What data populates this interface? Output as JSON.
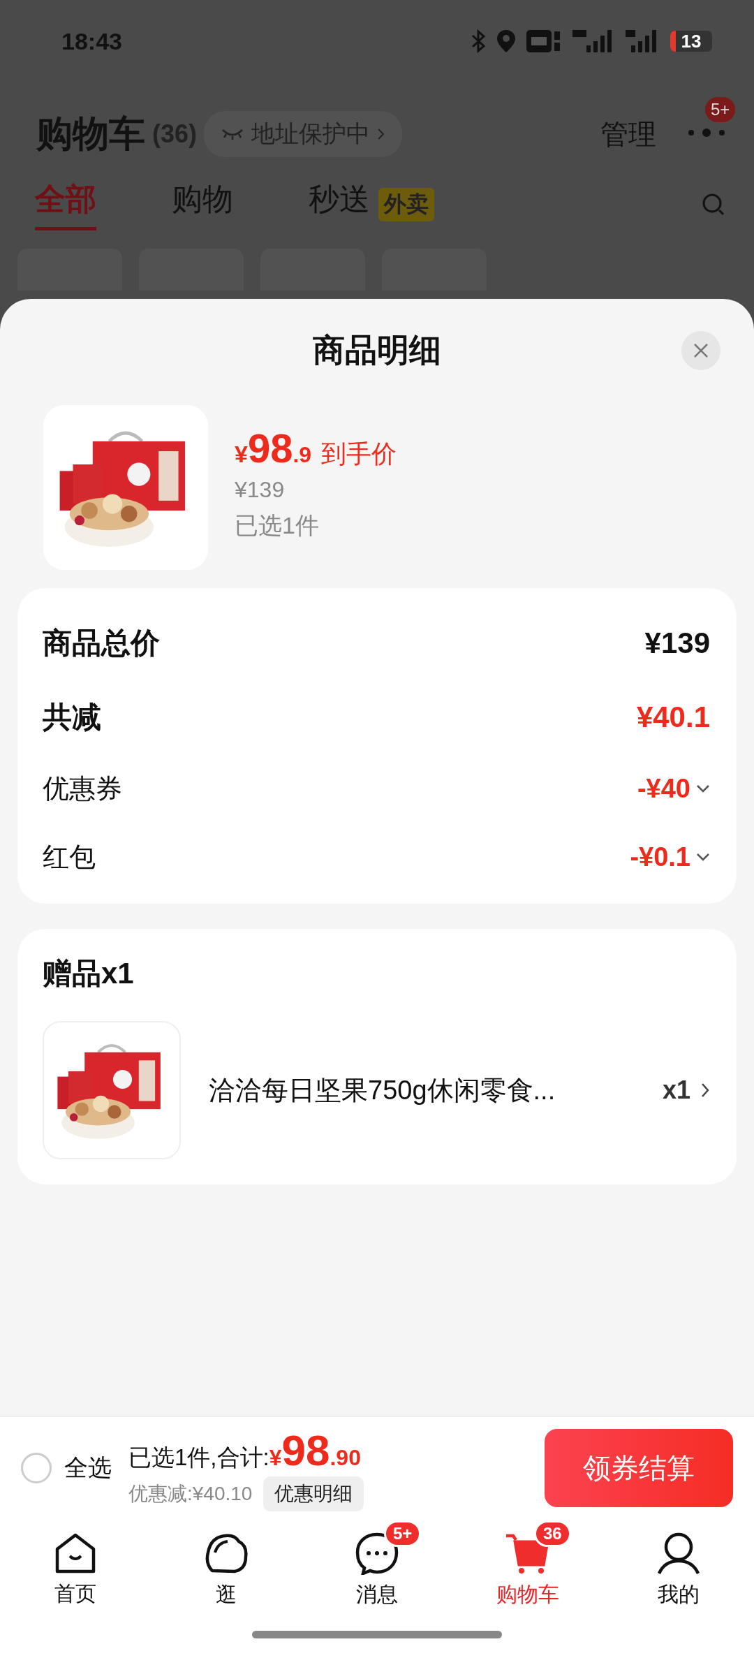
{
  "status_bar": {
    "time": "18:43",
    "battery": "13"
  },
  "header": {
    "title": "购物车",
    "count": "(36)",
    "address_badge": "地址保护中",
    "manage": "管理",
    "more_badge": "5+"
  },
  "tabs": [
    {
      "label": "全部",
      "selected": true
    },
    {
      "label": "购物",
      "selected": false
    },
    {
      "label": "秒送",
      "selected": false,
      "tag": "外卖"
    }
  ],
  "sheet": {
    "title": "商品明细",
    "product": {
      "currency": "¥",
      "price_whole": "98",
      "price_decimal": ".9",
      "price_label": "到手价",
      "original_price": "¥139",
      "selected_count": "已选1件"
    },
    "summary": [
      {
        "label": "商品总价",
        "value": "¥139",
        "kind": "total",
        "expandable": false
      },
      {
        "label": "共减",
        "value": "¥40.1",
        "kind": "discount",
        "expandable": false
      },
      {
        "label": "优惠券",
        "value": "-¥40",
        "kind": "detail",
        "expandable": true
      },
      {
        "label": "红包",
        "value": "-¥0.1",
        "kind": "detail",
        "expandable": true
      }
    ],
    "gift": {
      "title": "赠品x1",
      "items": [
        {
          "name": "洽洽每日坚果750g休闲零食...",
          "quantity": "x1"
        }
      ]
    }
  },
  "footer": {
    "select_all": {
      "label": "全选",
      "checked": false
    },
    "summary": "已选1件,合计:",
    "currency": "¥",
    "total_whole": "98",
    "total_decimal": ".90",
    "discount": "优惠减:¥40.10",
    "detail_button": "优惠明细",
    "checkout": "领券结算"
  },
  "nav": [
    {
      "label": "首页",
      "selected": false
    },
    {
      "label": "逛",
      "selected": false
    },
    {
      "label": "消息",
      "badge": "5+",
      "selected": false
    },
    {
      "label": "购物车",
      "badge": "36",
      "selected": true
    },
    {
      "label": "我的",
      "selected": false
    }
  ]
}
